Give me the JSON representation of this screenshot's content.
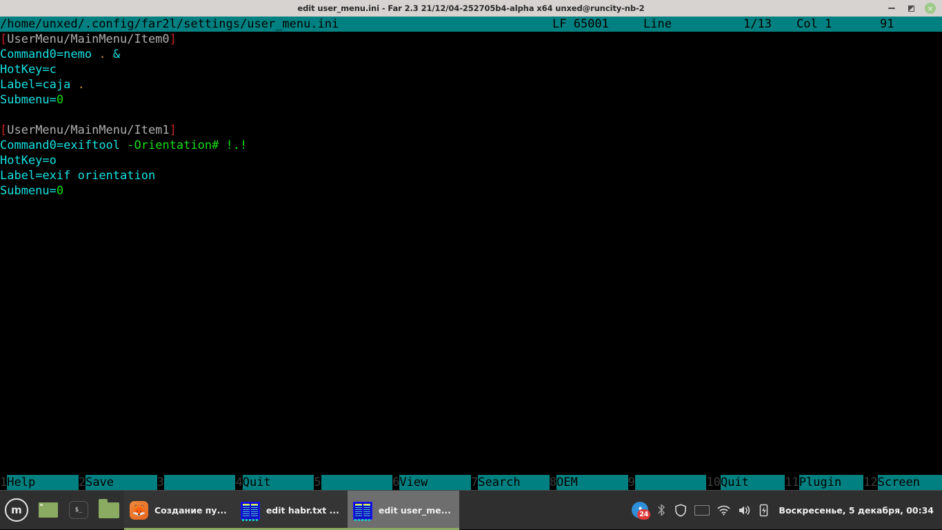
{
  "window": {
    "title": "edit user_menu.ini - Far 2.3 21/12/04-252705b4-alpha x64 unxed@runcity-nb-2",
    "controls": {
      "minimize": "minimize",
      "maximize": "maximize",
      "close": "×"
    }
  },
  "editor": {
    "path": "/home/unxed/.config/far2l/settings/user_menu.ini",
    "status": {
      "encoding": "LF 65001",
      "line_label": "Line",
      "line_value": "1/13",
      "col_label": "Col 1",
      "col_value": "91"
    },
    "lines": [
      {
        "n": 1,
        "segments": [
          {
            "t": "[",
            "c": "bracket"
          },
          {
            "t": "UserMenu/MainMenu/Item0",
            "c": "section"
          },
          {
            "t": "]",
            "c": "bracket"
          }
        ]
      },
      {
        "n": 2,
        "segments": [
          {
            "t": "Command0",
            "c": "key"
          },
          {
            "t": "=",
            "c": "eq"
          },
          {
            "t": "nemo ",
            "c": "val"
          },
          {
            "t": ".",
            "c": "dot"
          },
          {
            "t": " &",
            "c": "val"
          }
        ]
      },
      {
        "n": 3,
        "segments": [
          {
            "t": "HotKey",
            "c": "key"
          },
          {
            "t": "=",
            "c": "eq"
          },
          {
            "t": "c",
            "c": "val"
          }
        ]
      },
      {
        "n": 4,
        "segments": [
          {
            "t": "Label",
            "c": "key"
          },
          {
            "t": "=",
            "c": "eq"
          },
          {
            "t": "caja ",
            "c": "val"
          },
          {
            "t": ".",
            "c": "dot"
          }
        ]
      },
      {
        "n": 5,
        "segments": [
          {
            "t": "Submenu",
            "c": "key"
          },
          {
            "t": "=",
            "c": "eq"
          },
          {
            "t": "0",
            "c": "num"
          }
        ]
      },
      {
        "n": 6,
        "segments": []
      },
      {
        "n": 7,
        "segments": [
          {
            "t": "[",
            "c": "bracket"
          },
          {
            "t": "UserMenu/MainMenu/Item1",
            "c": "section"
          },
          {
            "t": "]",
            "c": "bracket"
          }
        ]
      },
      {
        "n": 8,
        "segments": [
          {
            "t": "Command0",
            "c": "key"
          },
          {
            "t": "=",
            "c": "eq"
          },
          {
            "t": "exiftool ",
            "c": "val"
          },
          {
            "t": "-Orientation# !.!",
            "c": "green"
          }
        ]
      },
      {
        "n": 9,
        "segments": [
          {
            "t": "HotKey",
            "c": "key"
          },
          {
            "t": "=",
            "c": "eq"
          },
          {
            "t": "o",
            "c": "val"
          }
        ]
      },
      {
        "n": 10,
        "segments": [
          {
            "t": "Label",
            "c": "key"
          },
          {
            "t": "=",
            "c": "eq"
          },
          {
            "t": "exif orientation",
            "c": "val"
          }
        ]
      },
      {
        "n": 11,
        "segments": [
          {
            "t": "Submenu",
            "c": "key"
          },
          {
            "t": "=",
            "c": "eq"
          },
          {
            "t": "0",
            "c": "num"
          }
        ]
      }
    ]
  },
  "fkeys": [
    {
      "num": "1",
      "label": "Help"
    },
    {
      "num": "2",
      "label": "Save"
    },
    {
      "num": "3",
      "label": ""
    },
    {
      "num": "4",
      "label": "Quit"
    },
    {
      "num": "5",
      "label": ""
    },
    {
      "num": "6",
      "label": "View"
    },
    {
      "num": "7",
      "label": "Search"
    },
    {
      "num": "8",
      "label": "OEM"
    },
    {
      "num": "9",
      "label": ""
    },
    {
      "num": "10",
      "label": "Quit"
    },
    {
      "num": "11",
      "label": "Plugin"
    },
    {
      "num": "12",
      "label": "Screen"
    }
  ],
  "taskbar": {
    "menu_label": "m",
    "launchers": [
      {
        "name": "show-desktop",
        "icon": "window-icon"
      },
      {
        "name": "terminal",
        "icon": "terminal-icon",
        "glyph": "$_"
      },
      {
        "name": "file-manager",
        "icon": "folder-icon"
      }
    ],
    "tasks": [
      {
        "label": "Создание пу...",
        "icon": "firefox-icon",
        "active": false
      },
      {
        "label": "edit habr.txt ...",
        "icon": "far-icon",
        "active": false
      },
      {
        "label": "edit user_me...",
        "icon": "far-icon",
        "active": true
      }
    ],
    "tray": {
      "update_badge": "24",
      "update_glyph": "⬆",
      "bluetooth_glyph": "ᛒ",
      "shield_glyph": "🛡",
      "flag_colors": [
        "#ffffff",
        "#1040b0",
        "#d02030"
      ],
      "wifi_glyph": "◗",
      "volume_glyph": "🔊",
      "power_glyph": "⌁",
      "clock": "Воскресенье, 5 декабря, 00:34"
    }
  }
}
